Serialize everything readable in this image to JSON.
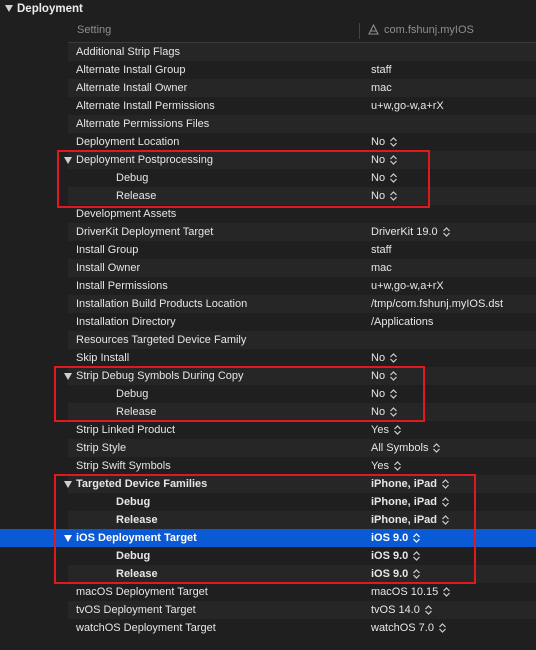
{
  "section": {
    "title": "Deployment"
  },
  "columns": {
    "setting": "Setting",
    "target": "com.fshunj.myIOS"
  },
  "rows": [
    {
      "name": "Additional Strip Flags",
      "value": "",
      "stepper": false
    },
    {
      "name": "Alternate Install Group",
      "value": "staff",
      "stepper": false
    },
    {
      "name": "Alternate Install Owner",
      "value": "mac",
      "stepper": false
    },
    {
      "name": "Alternate Install Permissions",
      "value": "u+w,go-w,a+rX",
      "stepper": false
    },
    {
      "name": "Alternate Permissions Files",
      "value": "",
      "stepper": false
    },
    {
      "name": "Deployment Location",
      "value": "No",
      "stepper": true
    },
    {
      "name": "Deployment Postprocessing",
      "value": "No",
      "stepper": true
    },
    {
      "name": "Debug",
      "value": "No",
      "stepper": true
    },
    {
      "name": "Release",
      "value": "No",
      "stepper": true
    },
    {
      "name": "Development Assets",
      "value": "",
      "stepper": false
    },
    {
      "name": "DriverKit Deployment Target",
      "value": "DriverKit 19.0",
      "stepper": true
    },
    {
      "name": "Install Group",
      "value": "staff",
      "stepper": false
    },
    {
      "name": "Install Owner",
      "value": "mac",
      "stepper": false
    },
    {
      "name": "Install Permissions",
      "value": "u+w,go-w,a+rX",
      "stepper": false
    },
    {
      "name": "Installation Build Products Location",
      "value": "/tmp/com.fshunj.myIOS.dst",
      "stepper": false
    },
    {
      "name": "Installation Directory",
      "value": "/Applications",
      "stepper": false
    },
    {
      "name": "Resources Targeted Device Family",
      "value": "",
      "stepper": false
    },
    {
      "name": "Skip Install",
      "value": "No",
      "stepper": true
    },
    {
      "name": "Strip Debug Symbols During Copy",
      "value": "No",
      "stepper": true
    },
    {
      "name": "Debug",
      "value": "No",
      "stepper": true
    },
    {
      "name": "Release",
      "value": "No",
      "stepper": true
    },
    {
      "name": "Strip Linked Product",
      "value": "Yes",
      "stepper": true
    },
    {
      "name": "Strip Style",
      "value": "All Symbols",
      "stepper": true
    },
    {
      "name": "Strip Swift Symbols",
      "value": "Yes",
      "stepper": true
    },
    {
      "name": "Targeted Device Families",
      "value": "iPhone, iPad",
      "stepper": true
    },
    {
      "name": "Debug",
      "value": "iPhone, iPad",
      "stepper": true
    },
    {
      "name": "Release",
      "value": "iPhone, iPad",
      "stepper": true
    },
    {
      "name": "iOS Deployment Target",
      "value": "iOS 9.0",
      "stepper": true
    },
    {
      "name": "Debug",
      "value": "iOS 9.0",
      "stepper": true
    },
    {
      "name": "Release",
      "value": "iOS 9.0",
      "stepper": true
    },
    {
      "name": "macOS Deployment Target",
      "value": "macOS 10.15",
      "stepper": true
    },
    {
      "name": "tvOS Deployment Target",
      "value": "tvOS 14.0",
      "stepper": true
    },
    {
      "name": "watchOS Deployment Target",
      "value": "watchOS 7.0",
      "stepper": true
    }
  ],
  "colors": {
    "selection": "#0a5ad6",
    "highlight_box": "#e0191e",
    "background": "#1f1f1f"
  }
}
